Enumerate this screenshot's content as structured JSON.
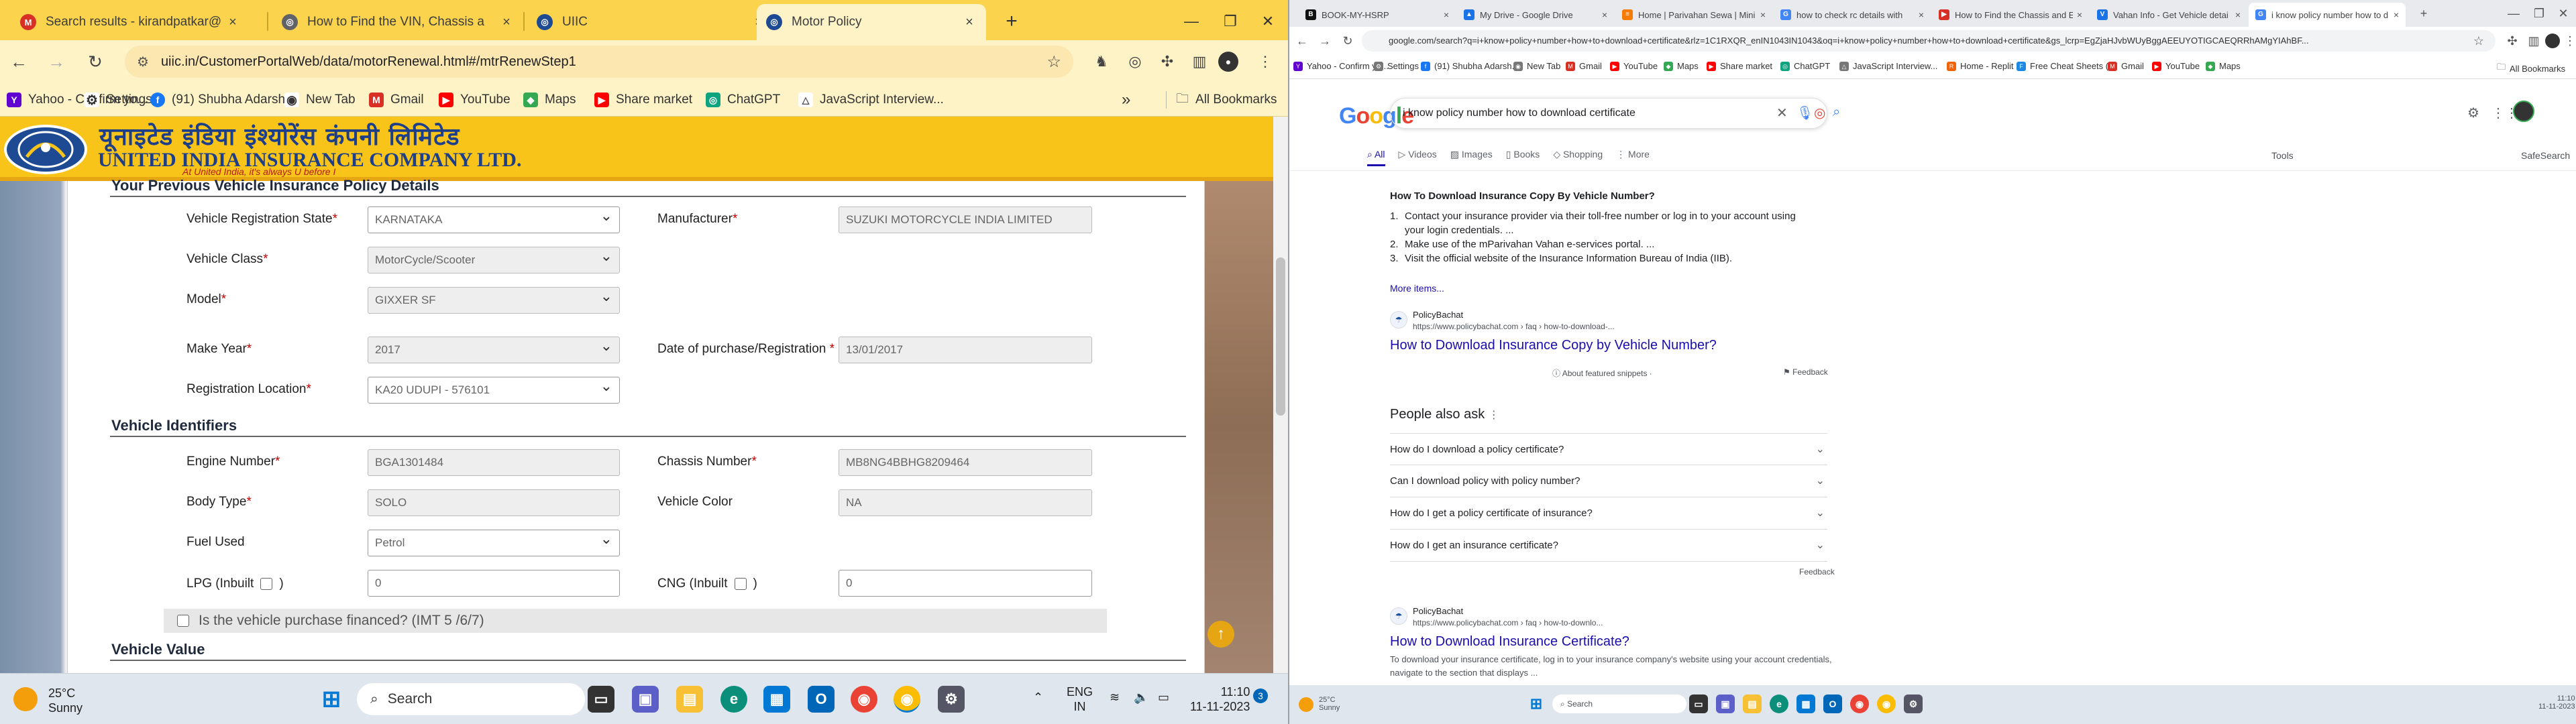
{
  "left": {
    "tabs": [
      {
        "title": "Search results - kirandpatkar@",
        "color": "#d93025",
        "letter": "M"
      },
      {
        "title": "How to Find the VIN, Chassis a",
        "color": "#5f6368",
        "letter": "◎"
      },
      {
        "title": "UIIC",
        "color": "#1d4a92",
        "letter": "◎"
      },
      {
        "title": "Motor Policy",
        "color": "#1d4a92",
        "letter": "◎"
      }
    ],
    "new_tab": "+",
    "url": "uiic.in/CustomerPortalWeb/data/motorRenewal.html#/mtrRenewStep1",
    "bookmarks": [
      {
        "label": "Yahoo - Confirm yo...",
        "color": "#6001d2",
        "letter": "Y"
      },
      {
        "label": "Settings",
        "color": "#5f6368",
        "letter": "⚙"
      },
      {
        "label": "(91) Shubha Adarsh...",
        "color": "#1877f2",
        "letter": "f"
      },
      {
        "label": "New Tab",
        "color": "#5f6368",
        "letter": "◉"
      },
      {
        "label": "Gmail",
        "color": "#d93025",
        "letter": "M"
      },
      {
        "label": "YouTube",
        "color": "#ff0000",
        "letter": "▶"
      },
      {
        "label": "Maps",
        "color": "#34a853",
        "letter": "◆"
      },
      {
        "label": "Share market",
        "color": "#ff0000",
        "letter": "▶"
      },
      {
        "label": "ChatGPT",
        "color": "#10a37f",
        "letter": "◎"
      },
      {
        "label": "JavaScript Interview...",
        "color": "#5f6368",
        "letter": "△"
      }
    ],
    "all_bookmarks": "All Bookmarks",
    "brand": {
      "hindi": "यूनाइटेड इंडिया इंश्योरेंस कंपनी लिमिटेड",
      "english": "UNITED INDIA INSURANCE COMPANY LTD.",
      "tagline": "At United India, it's always U before I"
    },
    "section_prev": "Your Previous Vehicle Insurance Policy Details",
    "fields_prev": {
      "reg_state": {
        "label": "Vehicle Registration State",
        "value": "KARNATAKA"
      },
      "manufacturer": {
        "label": "Manufacturer",
        "value": "SUZUKI MOTORCYCLE INDIA LIMITED"
      },
      "vehicle_class": {
        "label": "Vehicle Class",
        "value": "MotorCycle/Scooter"
      },
      "model": {
        "label": "Model",
        "value": "GIXXER SF"
      },
      "make_year": {
        "label": "Make Year",
        "value": "2017"
      },
      "purchase_date": {
        "label": "Date of purchase/Registration",
        "value": "13/01/2017"
      },
      "reg_location": {
        "label": "Registration Location",
        "value": "KA20 UDUPI - 576101"
      }
    },
    "section_ids": "Vehicle Identifiers",
    "fields_ids": {
      "engine": {
        "label": "Engine Number",
        "value": "BGA1301484"
      },
      "chassis": {
        "label": "Chassis Number",
        "value": "MB8NG4BBHG8209464"
      },
      "body": {
        "label": "Body Type",
        "value": "SOLO"
      },
      "color": {
        "label": "Vehicle Color",
        "value": "NA"
      },
      "fuel": {
        "label": "Fuel Used",
        "value": "Petrol"
      },
      "lpg": {
        "label": "LPG (Inbuilt",
        "suffix": ")",
        "value": "0"
      },
      "cng": {
        "label": "CNG (Inbuilt",
        "suffix": ")",
        "value": "0"
      }
    },
    "financed": "Is the vehicle purchase financed? (IMT 5 /6/7)",
    "section_value": "Vehicle Value",
    "taskbar": {
      "weather_temp": "25°C",
      "weather_desc": "Sunny",
      "search": "Search",
      "lang_1": "ENG",
      "lang_2": "IN",
      "time": "11:10",
      "date": "11-11-2023",
      "badge": "3"
    }
  },
  "right": {
    "tabs": [
      {
        "title": "BOOK-MY-HSRP",
        "color": "#111",
        "letter": "B"
      },
      {
        "title": "My Drive - Google Drive",
        "color": "#1a73e8",
        "letter": "▲"
      },
      {
        "title": "Home | Parivahan Sewa | Mini",
        "color": "#f57c00",
        "letter": "≡"
      },
      {
        "title": "how to check rc details with",
        "color": "#4285f4",
        "letter": "G"
      },
      {
        "title": "How to Find the Chassis and E",
        "color": "#d93025",
        "letter": "▶"
      },
      {
        "title": "Vahan Info - Get Vehicle detai",
        "color": "#1a73e8",
        "letter": "V"
      },
      {
        "title": "i know policy number how to d",
        "color": "#4285f4",
        "letter": "G"
      }
    ],
    "url": "google.com/search?q=i+know+policy+number+how+to+download+certificate&rlz=1C1RXQR_enIN1043IN1043&oq=i+know+policy+number+how+to+download+certificate&gs_lcrp=EgZjaHJvbWUyBggAEEUYOTIGCAEQRRhAMgYIAhBF...",
    "bookmarks": [
      "Yahoo - Confirm yo...",
      "Settings",
      "(91) Shubha Adarsh...",
      "New Tab",
      "Gmail",
      "YouTube",
      "Maps",
      "Share market",
      "ChatGPT",
      "JavaScript Interview...",
      "Home - Replit",
      "Free Cheat Sheets (...",
      "Gmail",
      "YouTube",
      "Maps"
    ],
    "all_bookmarks": "All Bookmarks",
    "google": {
      "logo": "Google",
      "query": "i know policy number how to download certificate",
      "tabs": [
        "All",
        "Videos",
        "Images",
        "Books",
        "Shopping",
        "More"
      ],
      "tools": "Tools",
      "safesearch": "SafeSearch",
      "snippet_title": "How To Download Insurance Copy By Vehicle Number?",
      "snippet_items": [
        "Contact your insurance provider via their toll-free number or log in to your account using your login credentials. ...",
        "Make use of the mParivahan Vahan e-services portal. ...",
        "Visit the official website of the Insurance Information Bureau of India (IIB)."
      ],
      "more_items": "More items...",
      "result1": {
        "site": "PolicyBachat",
        "url": "https://www.policybachat.com › faq › how-to-download-...",
        "title": "How to Download Insurance Copy by Vehicle Number?"
      },
      "about_snippets": "About featured snippets",
      "feedback": "Feedback",
      "paa_title": "People also ask",
      "paa": [
        "How do I download a policy certificate?",
        "Can I download policy with policy number?",
        "How do I get a policy certificate of insurance?",
        "How do I get an insurance certificate?"
      ],
      "result2": {
        "site": "PolicyBachat",
        "url": "https://www.policybachat.com › faq › how-to-downlo...",
        "title": "How to Download Insurance Certificate?",
        "desc": "To download your insurance certificate, log in to your insurance company's website using your account credentials, navigate to the section that displays ..."
      }
    },
    "taskbar": {
      "weather_temp": "25°C",
      "weather_desc": "Sunny",
      "search": "Search",
      "time": "11:10",
      "date": "11-11-2023"
    }
  }
}
